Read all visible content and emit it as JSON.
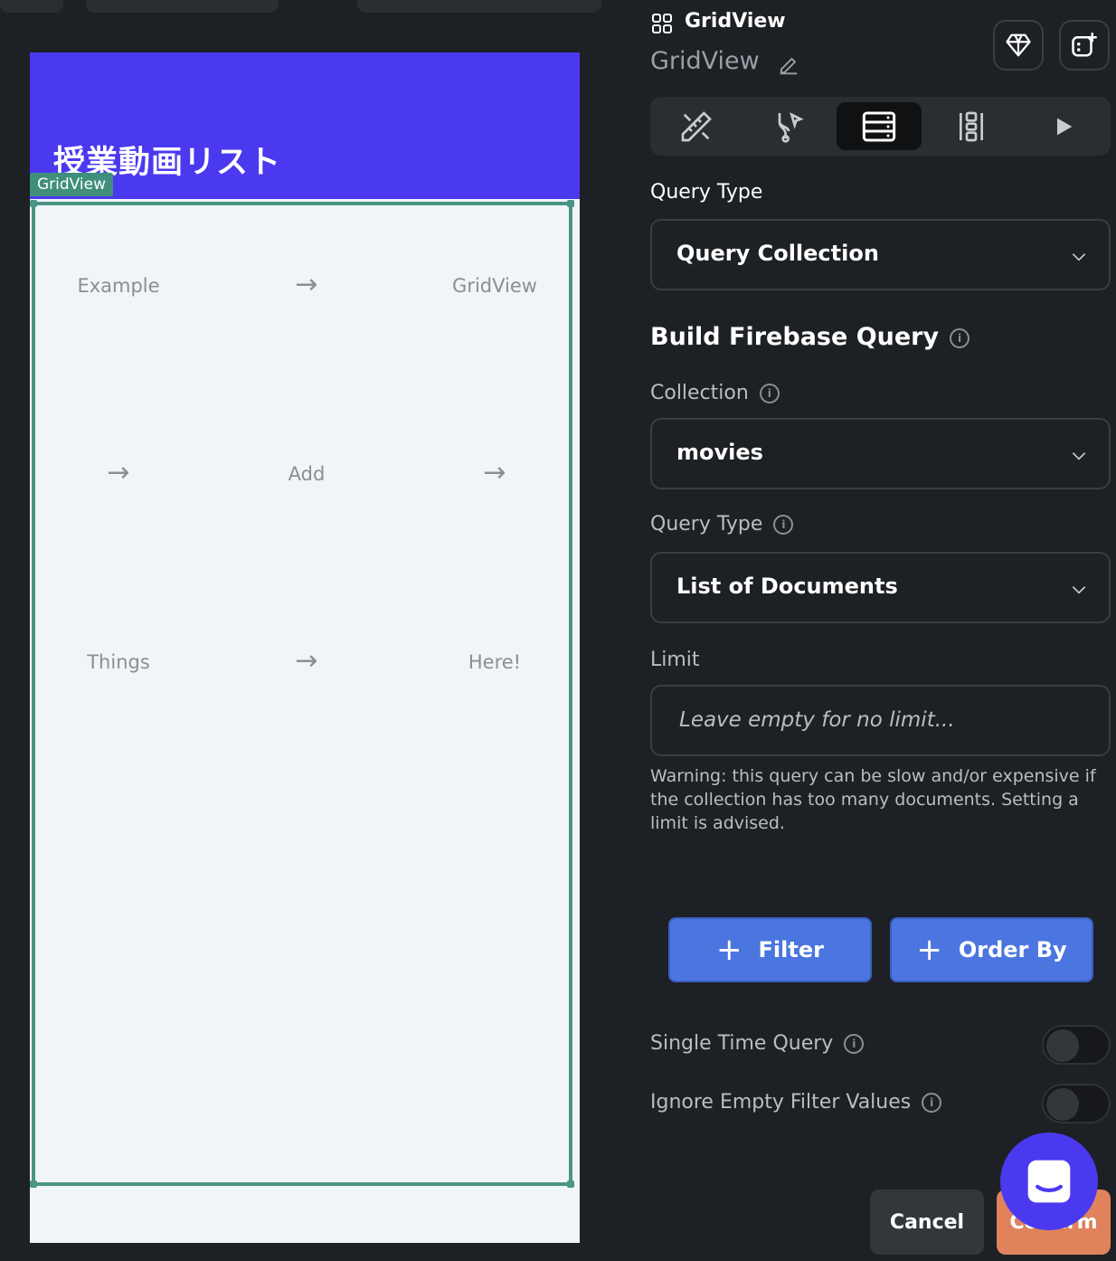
{
  "canvas": {
    "app_title": "授業動画リスト",
    "gridview_tag": "GridView",
    "grid": [
      [
        "Example",
        "→",
        "GridView"
      ],
      [
        "→",
        "Add",
        "→"
      ],
      [
        "Things",
        "→",
        "Here!"
      ]
    ]
  },
  "panel": {
    "header_title": "GridView",
    "widget_name": "GridView",
    "query_type_section": "Query Type",
    "query_type_value": "Query Collection",
    "build_heading": "Build Firebase Query",
    "collection_label": "Collection",
    "collection_value": "movies",
    "query_type_label": "Query Type",
    "query_type_list_value": "List of Documents",
    "limit_label": "Limit",
    "limit_placeholder": "Leave empty for no limit...",
    "warning": "Warning: this query can be slow and/or expensive if the collection has too many documents. Setting a limit is advised.",
    "filter_button": "Filter",
    "order_by_button": "Order By",
    "single_time_query": "Single Time Query",
    "single_time_query_enabled": false,
    "ignore_empty_filter": "Ignore Empty Filter Values",
    "ignore_empty_filter_enabled": false,
    "cancel_button": "Cancel",
    "confirm_button": "Confirm"
  },
  "colors": {
    "app_bar": "#4b39ef",
    "gridview_outline": "#4a9584",
    "primary_button": "#4b76e0",
    "confirm_button": "#e0835c"
  }
}
